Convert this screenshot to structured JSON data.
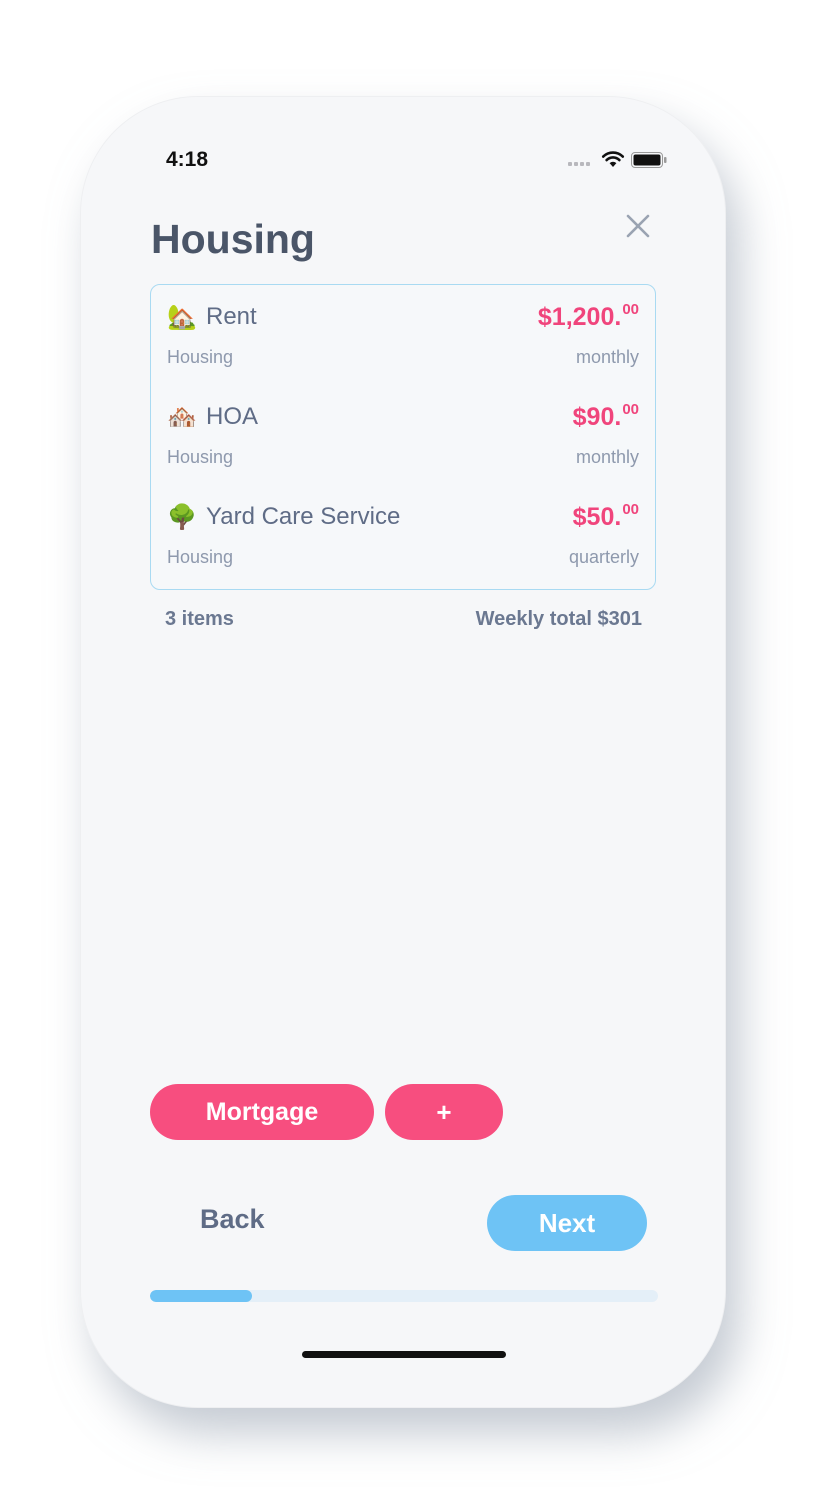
{
  "status_bar": {
    "time": "4:18",
    "icons": [
      "cellular-signal-icon",
      "wifi-icon",
      "battery-icon"
    ]
  },
  "header": {
    "title": "Housing",
    "close_icon": "close-icon"
  },
  "expenses": [
    {
      "emoji": "🏡",
      "name": "Rent",
      "amount": "$1,200.",
      "cents": "00",
      "category": "Housing",
      "frequency": "monthly"
    },
    {
      "emoji": "🏘️",
      "name": "HOA",
      "amount": "$90.",
      "cents": "00",
      "category": "Housing",
      "frequency": "monthly"
    },
    {
      "emoji": "🌳",
      "name": "Yard Care Service",
      "amount": "$50.",
      "cents": "00",
      "category": "Housing",
      "frequency": "quarterly"
    }
  ],
  "summary": {
    "count": "3 items",
    "weekly_total": "Weekly total $301"
  },
  "suggestions": {
    "mortgage_label": "Mortgage",
    "add_label": "+"
  },
  "navigation": {
    "back_label": "Back",
    "next_label": "Next"
  },
  "progress": {
    "value": 0.2
  },
  "colors": {
    "accent_pink": "#f74e7f",
    "amount_pink": "#f0457c",
    "accent_blue": "#6ec3f5",
    "card_border": "#a9daf2",
    "title_text": "#4a5568",
    "muted_text": "#8e99ad"
  }
}
